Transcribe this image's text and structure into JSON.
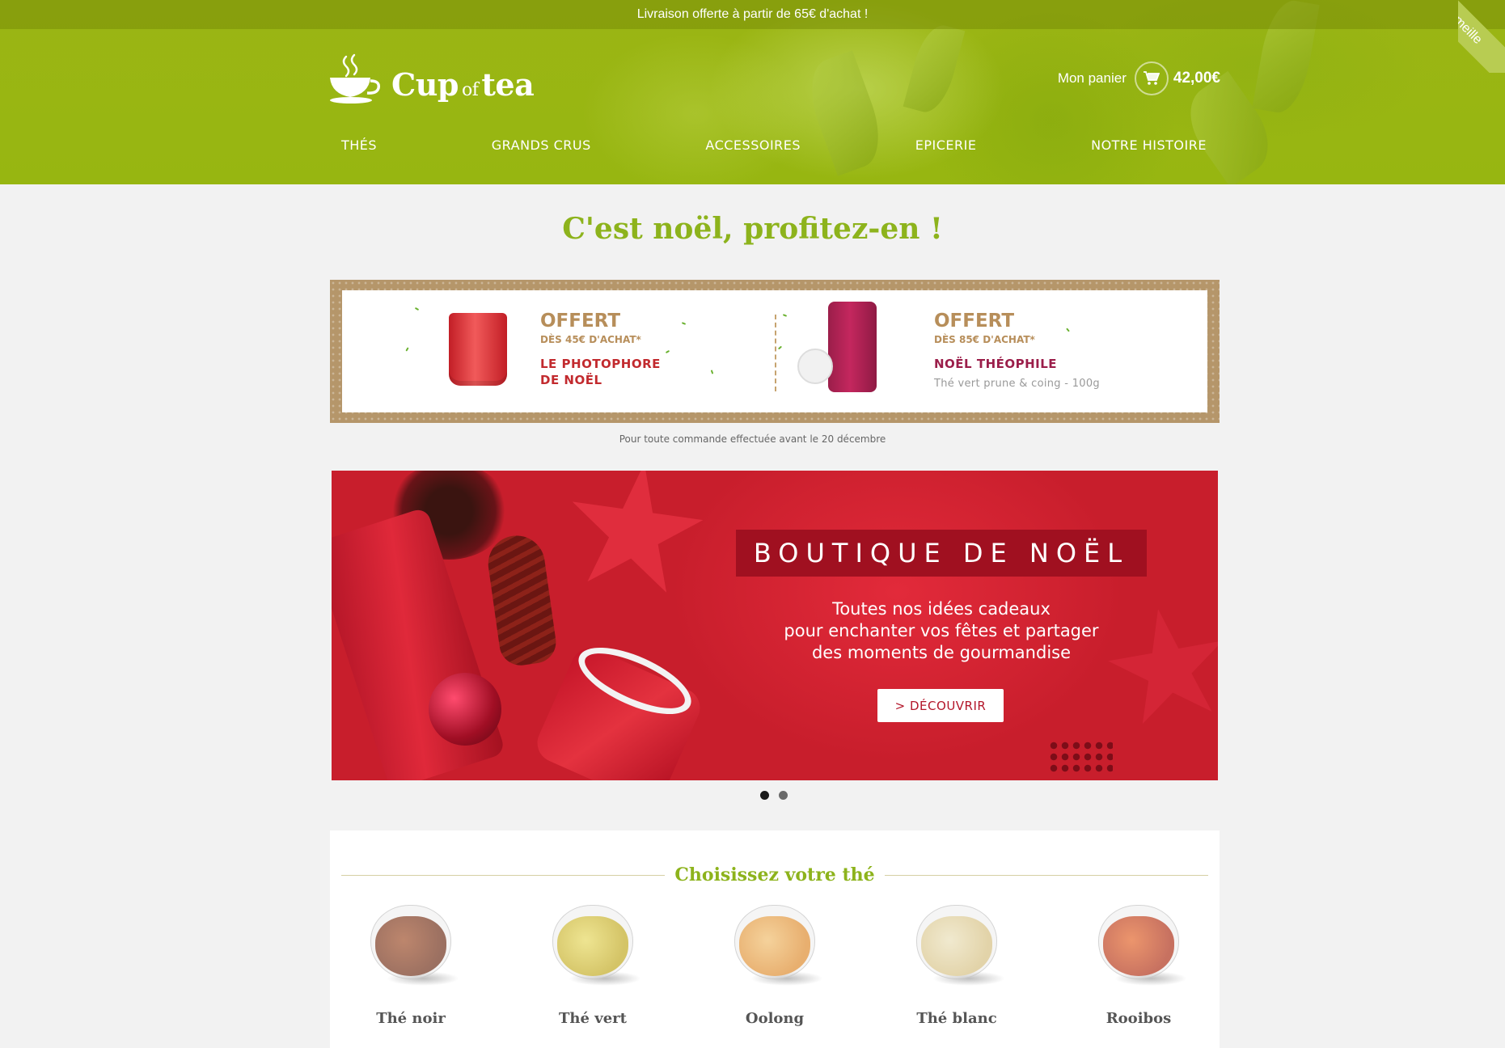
{
  "topbar": {
    "text": "Livraison offerte à partir de 65€ d'achat !",
    "corner_ribbon": "meille"
  },
  "logo": {
    "word1": "Cup",
    "word2": "of",
    "word3": "tea"
  },
  "cart": {
    "label": "Mon panier",
    "total": "42,00€",
    "icon": "cart-icon"
  },
  "nav": {
    "items": [
      {
        "label": "THÉS"
      },
      {
        "label": "GRANDS CRUS"
      },
      {
        "label": "ACCESSOIRES"
      },
      {
        "label": "EPICERIE"
      },
      {
        "label": "NOTRE HISTOIRE"
      }
    ]
  },
  "promo": {
    "title": "C'est noël, profitez-en !"
  },
  "offers": [
    {
      "title": "OFFERT",
      "condition": "DÈS 45€ D'ACHAT*",
      "name_line1": "LE PHOTOPHORE",
      "name_line2": "DE NOËL",
      "name_color": "#c22a2e"
    },
    {
      "title": "OFFERT",
      "condition": "DÈS 85€ D'ACHAT*",
      "name_line1": "NOËL THÉOPHILE",
      "description": "Thé vert prune & coing - 100g",
      "name_color": "#9b1e4a"
    }
  ],
  "offer_note": "Pour toute commande effectuée avant le 20 décembre",
  "hero": {
    "title": "BOUTIQUE DE NOËL",
    "line1": "Toutes nos idées cadeaux",
    "line2": "pour enchanter vos fêtes et partager",
    "line3": "des moments de gourmandise",
    "button": "> DÉCOUVRIR"
  },
  "carousel": {
    "active_index": 0,
    "count": 2
  },
  "tea_section": {
    "heading": "Choisissez votre thé",
    "items": [
      {
        "name": "Thé noir",
        "color": "#7a2a0e"
      },
      {
        "name": "Thé vert",
        "color": "#d9c21a"
      },
      {
        "name": "Oolong",
        "color": "#f2a53a"
      },
      {
        "name": "Thé blanc",
        "color": "#ecd9a0"
      },
      {
        "name": "Rooibos",
        "color": "#c8320f"
      }
    ]
  },
  "colors": {
    "brand_green": "#97b611",
    "accent_green": "#8db31c",
    "offer_gold": "#b78e5a",
    "hero_red": "#c81e2c"
  }
}
